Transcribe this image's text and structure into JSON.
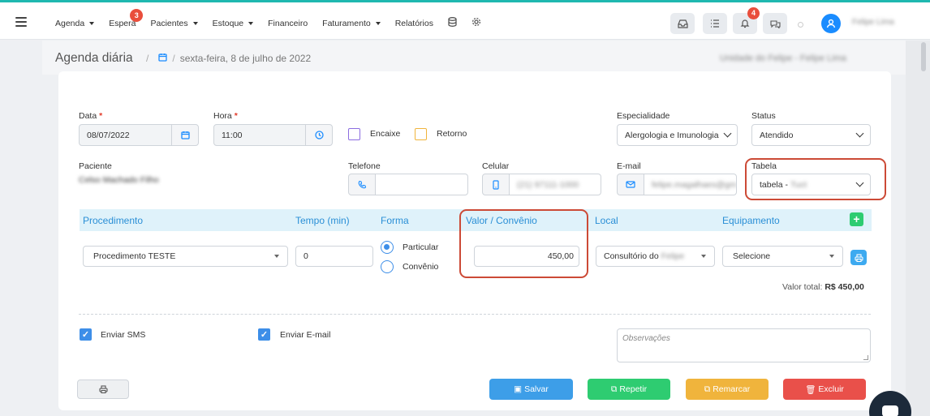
{
  "nav": {
    "items": [
      {
        "label": "Agenda",
        "has_caret": true
      },
      {
        "label": "Espera",
        "has_caret": false,
        "badge": "3"
      },
      {
        "label": "Pacientes",
        "has_caret": true
      },
      {
        "label": "Estoque",
        "has_caret": true
      },
      {
        "label": "Financeiro",
        "has_caret": false
      },
      {
        "label": "Faturamento",
        "has_caret": true
      },
      {
        "label": "Relatórios",
        "has_caret": false
      }
    ],
    "notification_badge": "4",
    "user_name": "Felipe Lima"
  },
  "header": {
    "title": "Agenda diária",
    "separator": "/",
    "date": "sexta-feira, 8 de julho de 2022",
    "unit": "Unidade do Felipe - Felipe Lima"
  },
  "form": {
    "data_label": "Data",
    "data_value": "08/07/2022",
    "hora_label": "Hora",
    "hora_value": "11:00",
    "encaixe_label": "Encaixe",
    "retorno_label": "Retorno",
    "especialidade_label": "Especialidade",
    "especialidade_value": "Alergologia e Imunologia",
    "status_label": "Status",
    "status_value": "Atendido",
    "paciente_label": "Paciente",
    "paciente_value": "Celso Machado Filho",
    "telefone_label": "Telefone",
    "celular_label": "Celular",
    "celular_value": "(21) 97111-1000",
    "email_label": "E-mail",
    "email_value": "felipe.magalhaes@gm",
    "tabela_label": "Tabela",
    "tabela_value_prefix": "tabela - ",
    "tabela_value_hidden": "Tuct"
  },
  "procedures": {
    "headers": {
      "procedimento": "Procedimento",
      "tempo": "Tempo (min)",
      "forma": "Forma",
      "valor": "Valor / Convênio",
      "local": "Local",
      "equipamento": "Equipamento"
    },
    "row": {
      "procedimento": "Procedimento TESTE",
      "tempo": "0",
      "forma_options": [
        "Particular",
        "Convênio"
      ],
      "forma_selected": "Particular",
      "valor": "450,00",
      "local_prefix": "Consultório do ",
      "local_hidden": "Felipe",
      "equipamento": "Selecione"
    },
    "total_label": "Valor total:",
    "total_value": "R$ 450,00"
  },
  "options": {
    "sms_label": "Enviar SMS",
    "email_label": "Enviar E-mail",
    "observacoes_placeholder": "Observações"
  },
  "actions": {
    "salvar": "Salvar",
    "repetir": "Repetir",
    "remarcar": "Remarcar",
    "excluir": "Excluir"
  },
  "colors": {
    "accent": "#1a8cff",
    "salvar": "#3d9ee8",
    "repetir": "#2ecc71",
    "remarcar": "#f0b43c",
    "excluir": "#e9504a",
    "highlight": "#cc4a36"
  },
  "icons": [
    "menu-icon",
    "inbox-icon",
    "list-icon",
    "bell-icon",
    "chat-icon",
    "user-icon",
    "calendar-icon",
    "clock-icon",
    "phone-icon",
    "mobile-icon",
    "envelope-icon",
    "printer-icon",
    "database-icon",
    "gear-icon"
  ]
}
